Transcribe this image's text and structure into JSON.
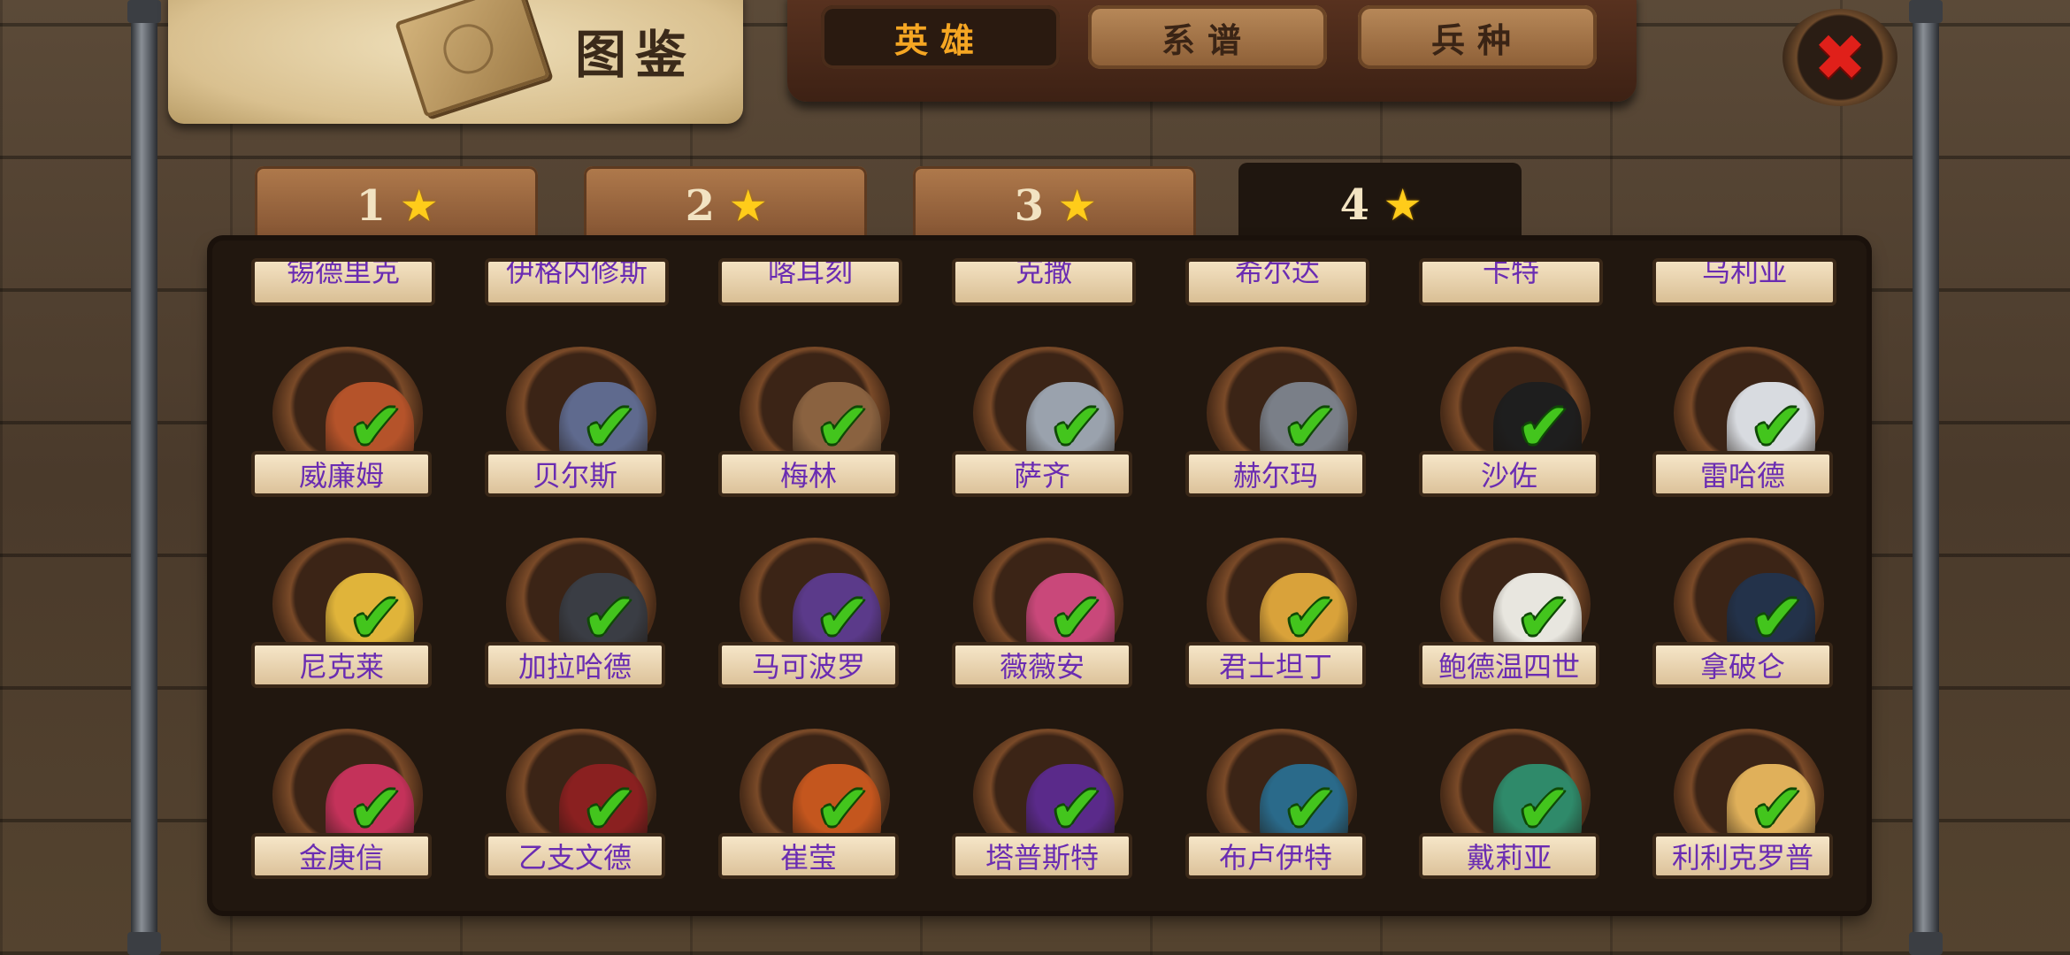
{
  "header": {
    "title": "图鉴"
  },
  "top_tabs": [
    {
      "label": "英雄",
      "active": true
    },
    {
      "label": "系谱",
      "active": false
    },
    {
      "label": "兵种",
      "active": false
    }
  ],
  "close_icon": "close-icon",
  "star_tabs": [
    {
      "label": "1",
      "active": false
    },
    {
      "label": "2",
      "active": false
    },
    {
      "label": "3",
      "active": false
    },
    {
      "label": "4",
      "active": true
    }
  ],
  "partial_row": [
    "锡德里克",
    "伊格内修斯",
    "喀耳刻",
    "克撒",
    "希尔达",
    "卡特",
    "乌利亚"
  ],
  "heroes": [
    {
      "name": "威廉姆",
      "color": "#b5532a"
    },
    {
      "name": "贝尔斯",
      "color": "#5f6a8e"
    },
    {
      "name": "梅林",
      "color": "#8a6240"
    },
    {
      "name": "萨齐",
      "color": "#9aa2ad"
    },
    {
      "name": "赫尔玛",
      "color": "#7a7f88"
    },
    {
      "name": "沙佐",
      "color": "#1e1e1e"
    },
    {
      "name": "雷哈德",
      "color": "#d8dbe0"
    },
    {
      "name": "尼克莱",
      "color": "#e0b43a"
    },
    {
      "name": "加拉哈德",
      "color": "#3a3d44"
    },
    {
      "name": "马可波罗",
      "color": "#5b3a8a"
    },
    {
      "name": "薇薇安",
      "color": "#c9487a"
    },
    {
      "name": "君士坦丁",
      "color": "#d9a23a"
    },
    {
      "name": "鲍德温四世",
      "color": "#e8e6df"
    },
    {
      "name": "拿破仑",
      "color": "#23324a"
    },
    {
      "name": "金庚信",
      "color": "#c4325a"
    },
    {
      "name": "乙支文德",
      "color": "#8a2020"
    },
    {
      "name": "崔莹",
      "color": "#c4561e"
    },
    {
      "name": "塔普斯特",
      "color": "#5a2a8a"
    },
    {
      "name": "布卢伊特",
      "color": "#2a6a8a"
    },
    {
      "name": "戴莉亚",
      "color": "#2f8a6a"
    },
    {
      "name": "利利克罗普",
      "color": "#e0b05a"
    }
  ]
}
